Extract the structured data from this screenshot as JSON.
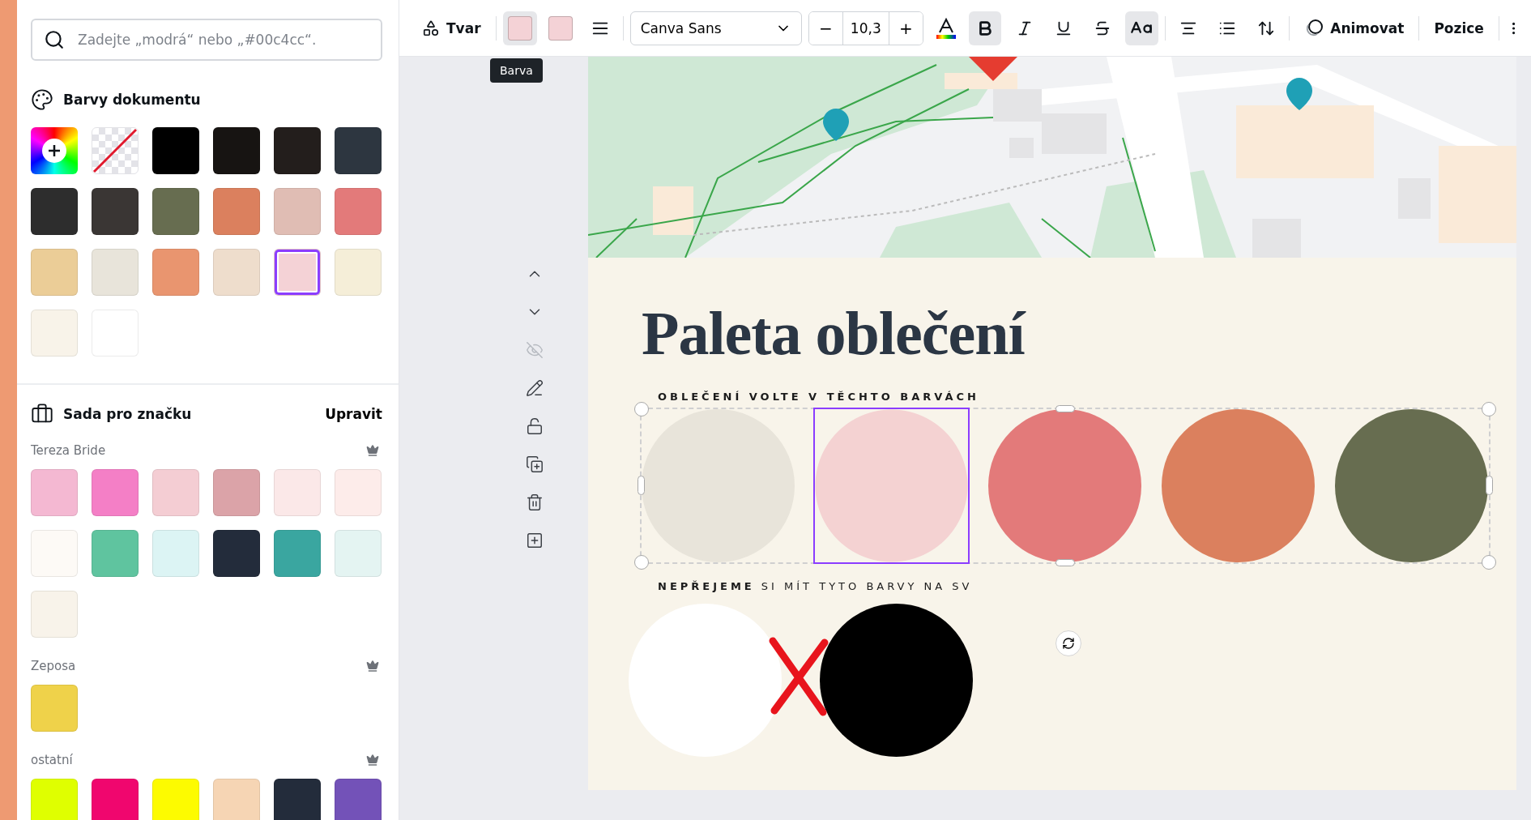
{
  "color_panel": {
    "search": {
      "placeholder": "Zadejte „modrá“ nebo „#00c4cc“."
    },
    "document_colors": {
      "title": "Barvy dokumentu",
      "swatches": [
        {
          "kind": "add",
          "selected": false
        },
        {
          "kind": "none",
          "selected": false
        },
        {
          "kind": "color",
          "color": "#000000",
          "selected": false
        },
        {
          "kind": "color",
          "color": "#171412",
          "selected": false
        },
        {
          "kind": "color",
          "color": "#231e1c",
          "selected": false
        },
        {
          "kind": "color",
          "color": "#2d3640",
          "selected": false
        },
        {
          "kind": "color",
          "color": "#2d2d2d",
          "selected": false
        },
        {
          "kind": "color",
          "color": "#3a3634",
          "selected": false
        },
        {
          "kind": "color",
          "color": "#676d50",
          "selected": false
        },
        {
          "kind": "color",
          "color": "#db805e",
          "selected": false
        },
        {
          "kind": "color",
          "color": "#e0bdb4",
          "selected": false
        },
        {
          "kind": "color",
          "color": "#e37a7a",
          "selected": false
        },
        {
          "kind": "color",
          "color": "#ebcd97",
          "selected": false
        },
        {
          "kind": "color",
          "color": "#e8e4da",
          "selected": false
        },
        {
          "kind": "color",
          "color": "#e9956f",
          "selected": false
        },
        {
          "kind": "color",
          "color": "#eeddcc",
          "selected": false
        },
        {
          "kind": "color",
          "color": "#f4d2d6",
          "selected": true
        },
        {
          "kind": "color",
          "color": "#f5eed8",
          "selected": false
        },
        {
          "kind": "color",
          "color": "#f8f3e9",
          "selected": false
        },
        {
          "kind": "color",
          "color": "#ffffff",
          "selected": false
        }
      ]
    },
    "brand_kit": {
      "title": "Sada pro značku",
      "edit": "Upravit",
      "palettes": [
        {
          "name": "Tereza Bride",
          "colors": [
            {
              "color": "#f4b8d2"
            },
            {
              "color": "#f47fc6"
            },
            {
              "color": "#f4cdd3"
            },
            {
              "color": "#dba3a8"
            },
            {
              "color": "#fbe8e8"
            },
            {
              "color": "#fdecea"
            },
            {
              "color": "#fdfaf6"
            },
            {
              "color": "#5fc49f"
            },
            {
              "color": "#dcf4f4"
            },
            {
              "color": "#232c3b"
            },
            {
              "color": "#3aa6a0"
            },
            {
              "color": "#e4f4f2"
            },
            {
              "color": "#f8f3ea"
            }
          ]
        },
        {
          "name": "Zeposa",
          "colors": [
            {
              "color": "#efd24a"
            }
          ]
        },
        {
          "name": "ostatní",
          "colors": [
            {
              "color": "#dfff00"
            },
            {
              "color": "#f0066e"
            },
            {
              "color": "#fdfb00"
            },
            {
              "color": "#f6d5b4"
            },
            {
              "color": "#232c3b"
            },
            {
              "color": "#7352b8"
            }
          ]
        }
      ]
    }
  },
  "toolbar": {
    "shape_button": "Tvar",
    "color_buttons": [
      {
        "color": "#f4d2d6",
        "selected": true
      },
      {
        "color": "#f4d2d6",
        "selected": false
      }
    ],
    "tooltip": "Barva",
    "font": "Canva Sans",
    "font_size": {
      "decrease": "−",
      "value": "10,3",
      "increase": "+"
    },
    "format_buttons": [
      {
        "kind": "text-color",
        "active": false
      },
      {
        "kind": "bold",
        "active": true
      },
      {
        "kind": "italic",
        "active": false
      },
      {
        "kind": "underline",
        "active": false
      },
      {
        "kind": "strikethrough",
        "active": false
      },
      {
        "kind": "case",
        "active": true
      },
      {
        "kind": "align",
        "active": false
      },
      {
        "kind": "list",
        "active": false
      },
      {
        "kind": "spacing",
        "active": false
      }
    ],
    "animate": "Animovat",
    "position": "Pozice"
  },
  "design": {
    "title": "Paleta oblečení",
    "wear_heading": "OBLEČENÍ VOLTE V TĚCHTO BARVÁCH",
    "wear_colors": [
      {
        "color": "#e8e4da",
        "selected": false
      },
      {
        "color": "#f4d2d2",
        "selected": true
      },
      {
        "color": "#e37a7a",
        "selected": false
      },
      {
        "color": "#db805e",
        "selected": false
      },
      {
        "color": "#676d50",
        "selected": false
      }
    ],
    "avoid_heading": "**NEPŘEJEME** SI MÍT TYTO BARVY NA SV",
    "avoid_colors": [
      {
        "color": "#ffffff"
      },
      {
        "color": "#000000"
      }
    ]
  }
}
